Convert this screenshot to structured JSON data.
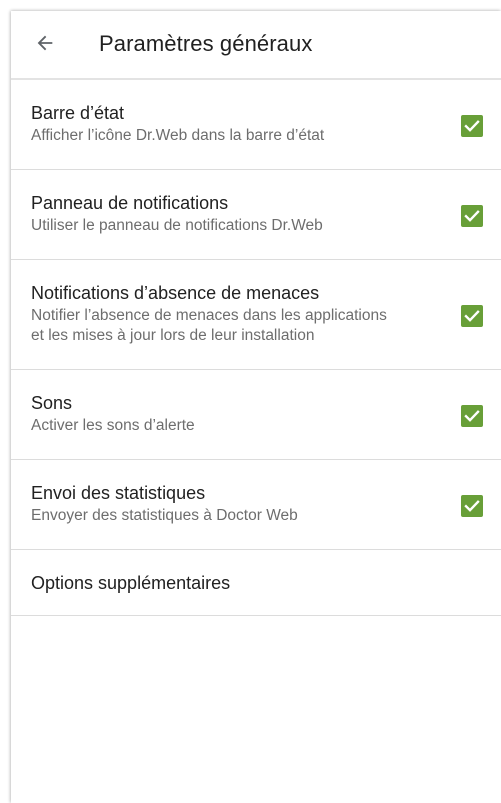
{
  "header": {
    "title": "Paramètres généraux",
    "back_icon": "arrow-left-icon"
  },
  "colors": {
    "checkbox": "#689f38",
    "title_text": "#212121",
    "subtitle_text": "#6d6d6d",
    "divider": "#dcdcdc"
  },
  "settings": [
    {
      "title": "Barre d’état",
      "subtitle": "Afficher l’icône Dr.Web dans la barre d’état",
      "checked": true
    },
    {
      "title": "Panneau de notifications",
      "subtitle": "Utiliser le panneau de notifications Dr.Web",
      "checked": true
    },
    {
      "title": "Notifications d’absence de menaces",
      "subtitle": "Notifier l’absence de menaces dans les applications\net les mises à jour lors de leur installation",
      "checked": true
    },
    {
      "title": "Sons",
      "subtitle": "Activer les sons d’alerte",
      "checked": true
    },
    {
      "title": "Envoi des statistiques",
      "subtitle": "Envoyer des statistiques à Doctor Web",
      "checked": true
    },
    {
      "title": "Options supplémentaires"
    }
  ]
}
